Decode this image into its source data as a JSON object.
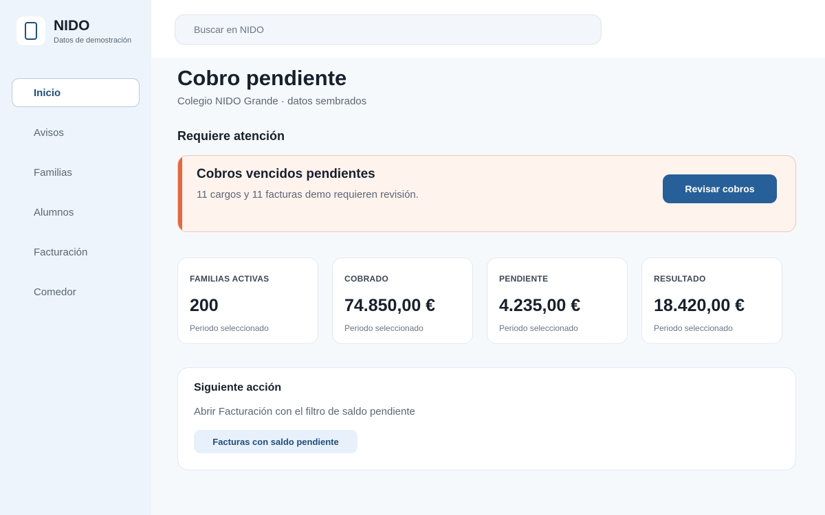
{
  "brand": {
    "name": "NIDO",
    "subtitle": "Datos de demostración",
    "logo_icon": "phone-outline-icon"
  },
  "search": {
    "placeholder": "Buscar en NIDO"
  },
  "nav": {
    "items": [
      {
        "label": "Inicio",
        "active": true
      },
      {
        "label": "Avisos"
      },
      {
        "label": "Familias"
      },
      {
        "label": "Alumnos"
      },
      {
        "label": "Facturación"
      },
      {
        "label": "Comedor"
      }
    ]
  },
  "page": {
    "title": "Cobro pendiente",
    "subtitle": "Colegio NIDO Grande · datos sembrados"
  },
  "attention": {
    "title": "Requiere atención",
    "alert": {
      "title": "Cobros vencidos pendientes",
      "text": "11 cargos y 11 facturas demo requieren revisión.",
      "button": "Revisar cobros"
    }
  },
  "stats": [
    {
      "label": "FAMILIAS ACTIVAS",
      "value": "200",
      "note": "Periodo seleccionado"
    },
    {
      "label": "COBRADO",
      "value": "74.850,00 €",
      "note": "Periodo seleccionado"
    },
    {
      "label": "PENDIENTE",
      "value": "4.235,00 €",
      "note": "Periodo seleccionado"
    },
    {
      "label": "RESULTADO",
      "value": "18.420,00 €",
      "note": "Periodo seleccionado"
    }
  ],
  "next_action": {
    "title": "Siguiente acción",
    "text": "Abrir Facturación con el filtro de saldo pendiente",
    "button": "Facturas con saldo pendiente"
  },
  "colors": {
    "accent": "#275f99",
    "alert_bar": "#e5683f",
    "alert_bg": "#fff3ee",
    "sidebar_bg": "#edf4fb"
  }
}
